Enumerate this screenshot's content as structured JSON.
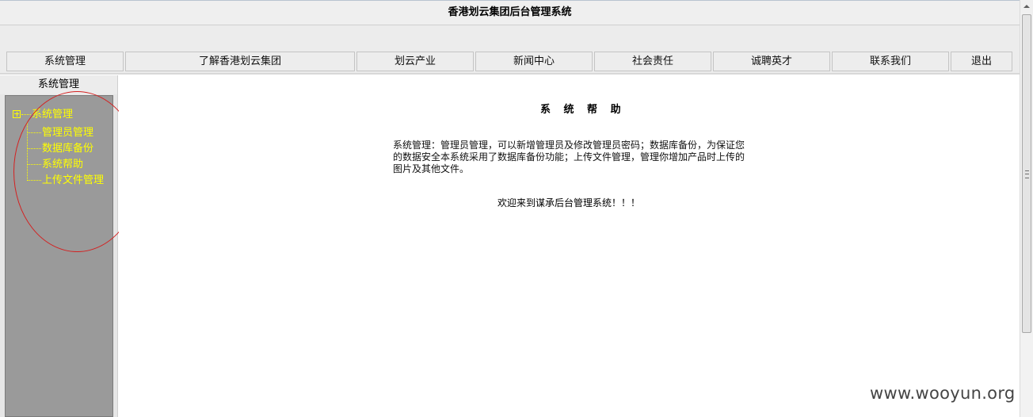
{
  "window": {
    "title": "香港划云集团后台管理系统"
  },
  "nav": {
    "items": [
      {
        "label": "系统管理"
      },
      {
        "label": "了解香港划云集团"
      },
      {
        "label": "划云产业"
      },
      {
        "label": "新闻中心"
      },
      {
        "label": "社会责任"
      },
      {
        "label": "诚聘英才"
      },
      {
        "label": "联系我们"
      },
      {
        "label": "退出"
      }
    ]
  },
  "sidebar": {
    "header": "系统管理",
    "tree": {
      "root_label": "系统管理",
      "children": [
        {
          "label": "管理员管理"
        },
        {
          "label": "数据库备份"
        },
        {
          "label": "系统帮助"
        },
        {
          "label": "上传文件管理"
        }
      ]
    },
    "tree_text_color": "#ffff00",
    "panel_color": "#9a9a9a"
  },
  "content": {
    "title": "系 统 帮 助",
    "help_text": "系统管理：管理员管理，可以新增管理员及修改管理员密码；数据库备份，为保证您的数据安全本系统采用了数据库备份功能；上传文件管理，管理你增加产品时上传的图片及其他文件。",
    "welcome": "欢迎来到谋承后台管理系统！！！"
  },
  "annotation": {
    "color": "#d42020"
  },
  "watermark": {
    "text": "www.wooyun.org"
  }
}
